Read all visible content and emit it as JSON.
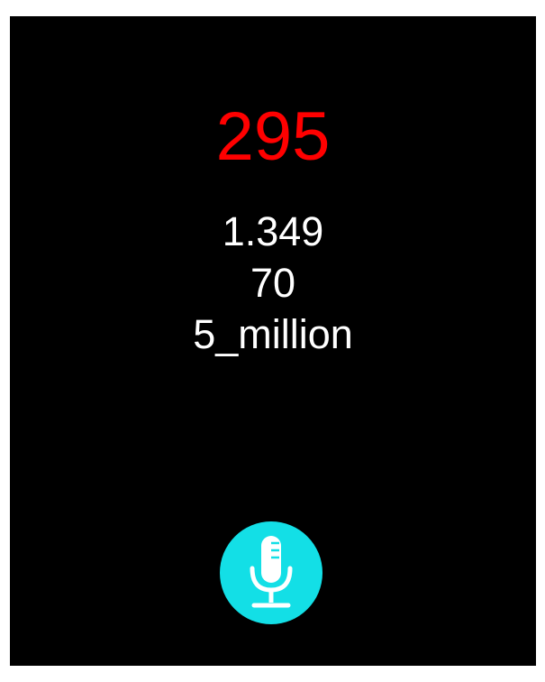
{
  "screen": {
    "headline": "295",
    "lines": [
      "1.349",
      "70",
      "5_million"
    ]
  },
  "colors": {
    "background": "#000000",
    "headline": "#ff0000",
    "text": "#ffffff",
    "mic_button": "#13dfe6",
    "mic_icon": "#ffffff"
  },
  "mic": {
    "icon": "microphone-icon"
  }
}
